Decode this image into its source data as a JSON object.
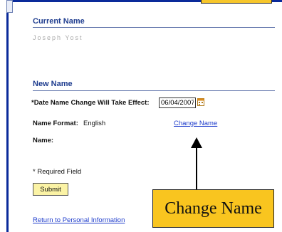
{
  "current_section": {
    "title": "Current Name",
    "name_value": "Joseph Yost"
  },
  "new_section": {
    "title": "New Name",
    "date_label": "*Date Name Change Will Take Effect:",
    "date_value": "06/04/2007",
    "name_format_label": "Name Format:",
    "name_format_value": "English",
    "change_name_link": "Change Name",
    "name_label": "Name:"
  },
  "required_note": "* Required Field",
  "submit_label": "Submit",
  "return_link": "Return to Personal Information",
  "callout_text": "Change Name",
  "icons": {
    "calendar": "calendar-icon"
  },
  "colors": {
    "frame": "#0a2a9a",
    "heading": "#1f3d8f",
    "link": "#1f3dcc",
    "callout": "#f9c51f",
    "button": "#fbf3a5"
  }
}
